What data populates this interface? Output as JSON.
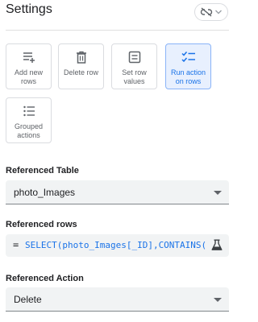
{
  "header": {
    "title": "Settings",
    "link_icon": "link-off-icon",
    "chevron_icon": "chevron-down-icon"
  },
  "action_types": [
    {
      "label": "Add new\nrows",
      "icon": "add-rows-icon",
      "selected": false
    },
    {
      "label": "Delete row",
      "icon": "trash-icon",
      "selected": false
    },
    {
      "label": "Set row\nvalues",
      "icon": "edit-row-icon",
      "selected": false
    },
    {
      "label": "Run action\non rows",
      "icon": "checklist-icon",
      "selected": true
    },
    {
      "label": "Grouped\nactions",
      "icon": "list-icon",
      "selected": false
    }
  ],
  "referenced_table": {
    "label": "Referenced Table",
    "value": "photo_Images"
  },
  "referenced_rows": {
    "label": "Referenced rows",
    "prefix": "=",
    "expression": "SELECT(photo_Images[_ID],CONTAINS(",
    "icon": "flask-icon"
  },
  "referenced_action": {
    "label": "Referenced Action",
    "value": "Delete"
  },
  "colors": {
    "accent": "#1a73e8",
    "selected_bg": "#e8f0fe",
    "field_bg": "#f1f3f4"
  }
}
